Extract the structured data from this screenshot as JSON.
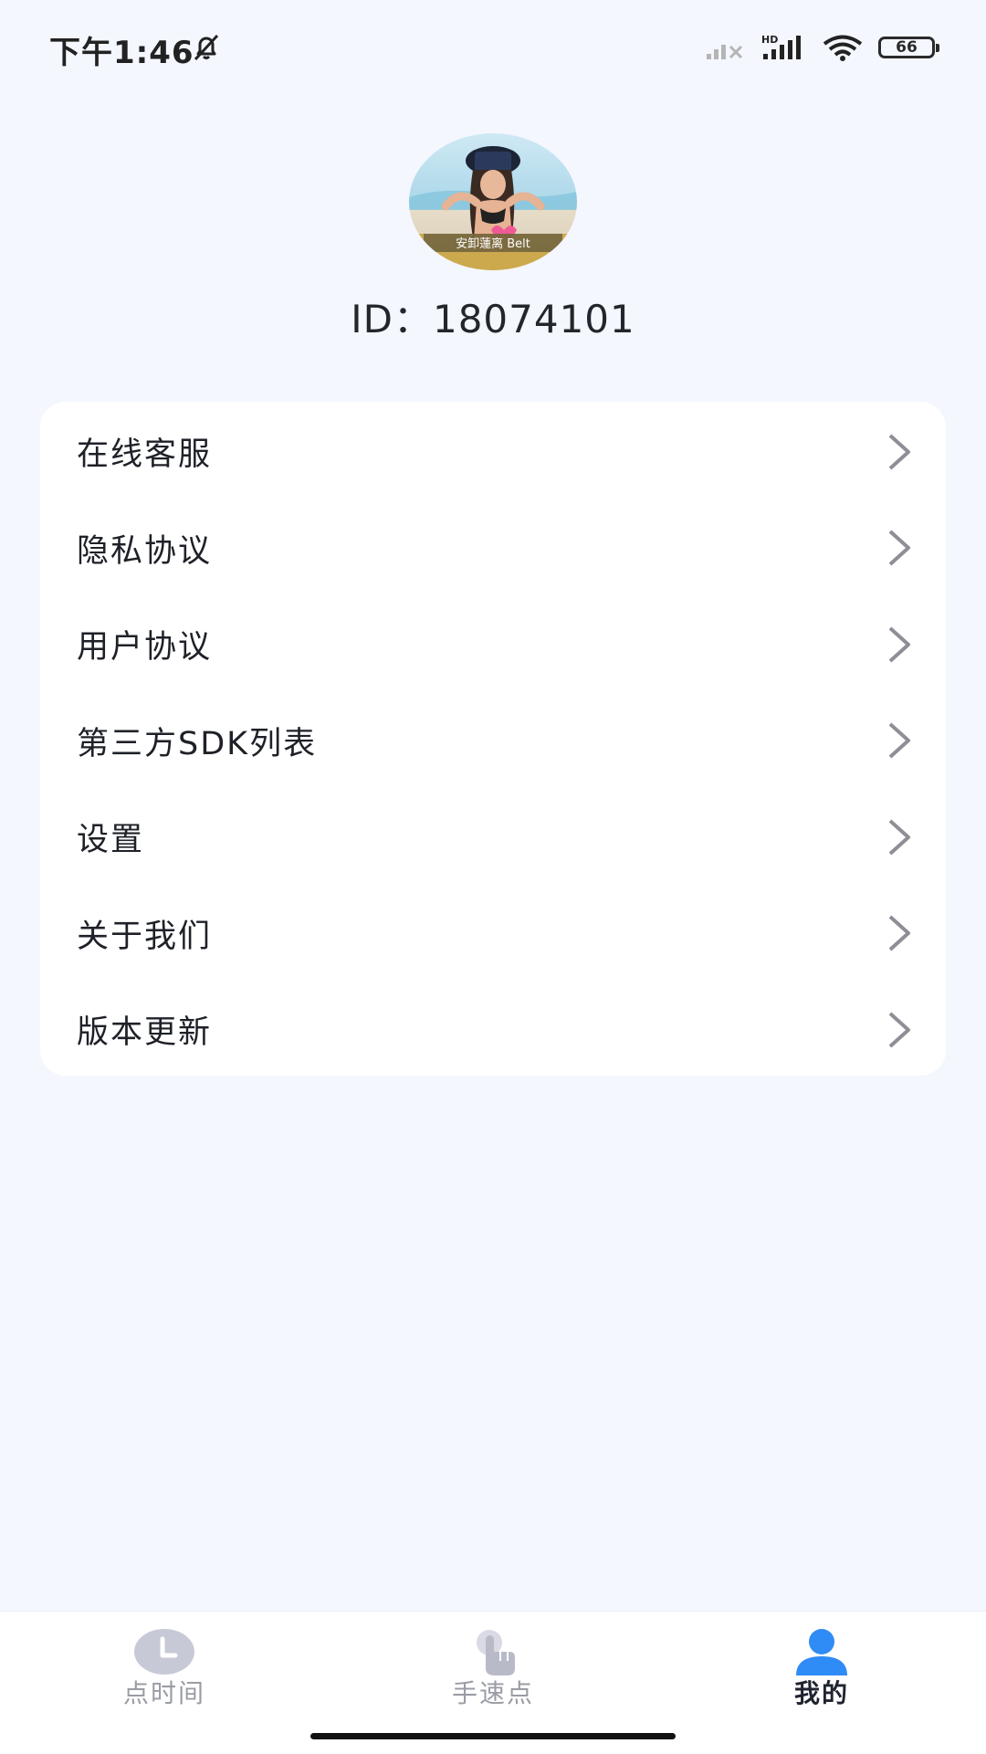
{
  "status_bar": {
    "time": "下午1:46",
    "battery": "66"
  },
  "profile": {
    "id_label": "ID：",
    "id_value": "18074101",
    "avatar_caption": "安卸蓮离 Belt"
  },
  "menu": {
    "items": [
      {
        "label": "在线客服"
      },
      {
        "label": "隐私协议"
      },
      {
        "label": "用户协议"
      },
      {
        "label": "第三方SDK列表"
      },
      {
        "label": "设置"
      },
      {
        "label": "关于我们"
      },
      {
        "label": "版本更新"
      }
    ]
  },
  "tabs": [
    {
      "label": "点时间",
      "icon": "clock-icon",
      "active": false
    },
    {
      "label": "手速点",
      "icon": "tap-hand-icon",
      "active": false
    },
    {
      "label": "我的",
      "icon": "user-icon",
      "active": true
    }
  ],
  "colors": {
    "background": "#f4f7fe",
    "card": "#ffffff",
    "accent": "#2f8bf5",
    "chevron": "#8e8f96"
  }
}
